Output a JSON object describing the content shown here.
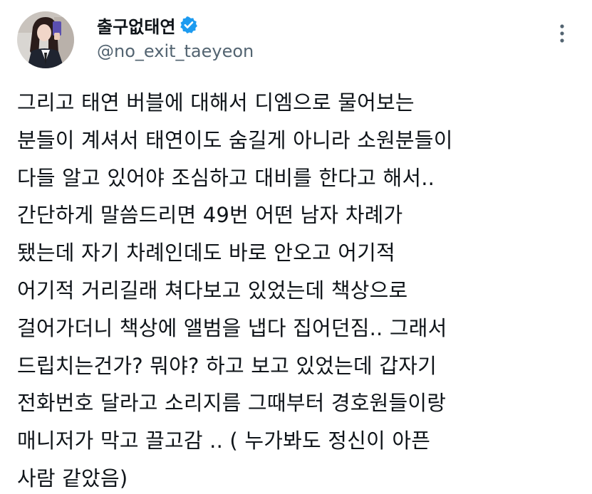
{
  "author": {
    "display_name": "출구없태연",
    "handle": "@no_exit_taeyeon",
    "verified": true,
    "avatar_icon": "profile-photo",
    "verified_icon": "verified-badge-icon",
    "verified_color": "#1d9bf0",
    "more_icon": "more-vertical-icon"
  },
  "tweet": {
    "lines": [
      "그리고 태연 버블에 대해서 디엠으로 물어보는",
      "분들이 계셔서 태연이도 숨길게 아니라 소원분들이",
      "다들 알고 있어야 조심하고 대비를 한다고 해서..",
      "간단하게 말씀드리면 49번 어떤 남자 차례가",
      "됐는데 자기 차례인데도 바로 안오고 어기적",
      "어기적 거리길래 쳐다보고 있었는데 책상으로",
      "걸어가더니 책상에 앨범을 냅다 집어던짐.. 그래서",
      "드립치는건가? 뭐야? 하고 보고 있었는데 갑자기",
      "전화번호 달라고 소리지름 그때부터 경호원들이랑",
      "매니저가 막고 끌고감 .. ( 누가봐도 정신이 아픈",
      "사람 같았음)"
    ]
  },
  "colors": {
    "text": "#0f1419",
    "secondary": "#536471",
    "background": "#ffffff"
  }
}
